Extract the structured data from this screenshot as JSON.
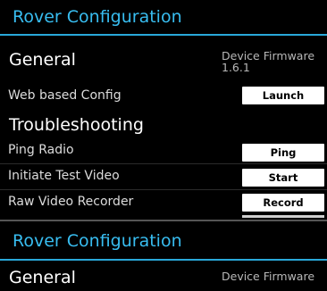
{
  "panel_top": {
    "title": "Rover Configuration",
    "general": {
      "heading": "General",
      "firmware_label": "Device Firmware",
      "firmware_version": "1.6.1"
    },
    "web_config": {
      "label": "Web based Config",
      "button": "Launch"
    },
    "troubleshooting": {
      "heading": "Troubleshooting",
      "rows": [
        {
          "label": "Ping Radio",
          "button": "Ping"
        },
        {
          "label": "Initiate Test Video",
          "button": "Start"
        },
        {
          "label": "Raw Video Recorder",
          "button": "Record"
        }
      ]
    }
  },
  "panel_bottom": {
    "title": "Rover Configuration",
    "general": {
      "heading": "General",
      "firmware_label": "Device Firmware"
    }
  },
  "colors": {
    "accent": "#38bdf0",
    "background": "#000000",
    "button_bg": "#ffffff"
  }
}
